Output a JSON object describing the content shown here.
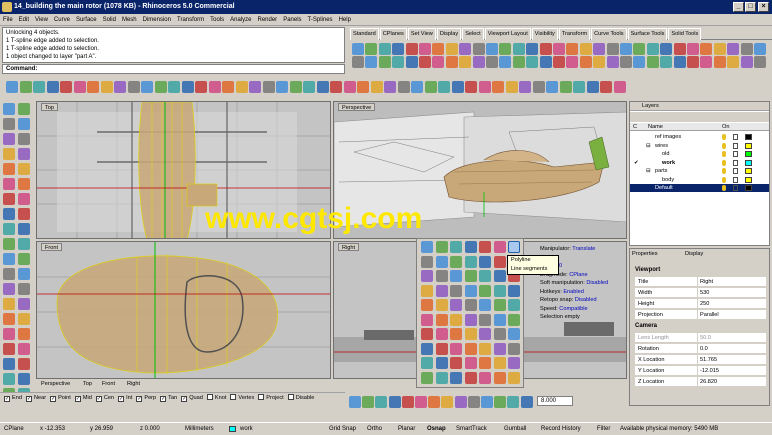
{
  "window": {
    "title": "14_building the main rotor (1078 KB) - Rhinoceros 5.0 Commercial",
    "controls": [
      "_",
      "□",
      "×"
    ]
  },
  "menu": [
    "File",
    "Edit",
    "View",
    "Curve",
    "Surface",
    "Solid",
    "Mesh",
    "Dimension",
    "Transform",
    "Tools",
    "Analyze",
    "Render",
    "Panels",
    "T-Splines",
    "Help"
  ],
  "command_history": [
    "Unlocking 4 objects.",
    "1 T-spline edge added to selection.",
    "1 T-spline edge added to selection.",
    "1 object changed to layer \"part A\"."
  ],
  "command_prompt": "Command:",
  "toolbar_tabs": [
    "Standard",
    "CPlanes",
    "Set View",
    "Display",
    "Select",
    "Viewport Layout",
    "Visibility",
    "Transform",
    "Curve Tools",
    "Surface Tools",
    "Solid Tools"
  ],
  "viewports": {
    "top": "Top",
    "perspective": "Perspective",
    "front": "Front",
    "right": "Right"
  },
  "viewport_tabs": [
    "Perspective",
    "Top",
    "Front",
    "Right"
  ],
  "layers": {
    "title": "Layers",
    "col_name": "Name",
    "col_on": "On",
    "rows": [
      {
        "name": "ref images",
        "indent": 1,
        "color": "#000000"
      },
      {
        "name": "wires",
        "indent": 1,
        "color": "#ffff00",
        "expand": "⊟"
      },
      {
        "name": "old",
        "indent": 2,
        "color": "#00ff00"
      },
      {
        "name": "work",
        "indent": 2,
        "color": "#00ffff",
        "bold": true,
        "check": "✔"
      },
      {
        "name": "parts",
        "indent": 1,
        "color": "#ffff00",
        "expand": "⊟"
      },
      {
        "name": "body",
        "indent": 2,
        "color": "#ffff00"
      },
      {
        "name": "Default",
        "indent": 1,
        "color": "#000000",
        "selected": true
      }
    ]
  },
  "properties": {
    "tab_properties": "Properties",
    "tab_display": "Display",
    "section_viewport": "Viewport",
    "section_camera": "Camera",
    "viewport_rows": [
      {
        "k": "Title",
        "v": "Right"
      },
      {
        "k": "Width",
        "v": "530"
      },
      {
        "k": "Height",
        "v": "250"
      },
      {
        "k": "Projection",
        "v": "Parallel"
      }
    ],
    "camera_rows": [
      {
        "k": "Lens Length",
        "v": "50.0"
      },
      {
        "k": "Rotation",
        "v": "0.0"
      },
      {
        "k": "X Location",
        "v": "51.765"
      },
      {
        "k": "Y Location",
        "v": "-12.015"
      },
      {
        "k": "Z Location",
        "v": "26.820"
      }
    ]
  },
  "tspline_info": [
    {
      "k": "Manipulator:",
      "v": "Translate"
    },
    {
      "k": "",
      "v": "Objects"
    },
    {
      "k": "er:",
      "v": "1.000"
    },
    {
      "k": "Dragmode:",
      "v": "CPlane"
    },
    {
      "k": "Soft manipulation:",
      "v": "Disabled"
    },
    {
      "k": "Hotkeys:",
      "v": "Enabled"
    },
    {
      "k": "Retopo snap:",
      "v": "Disabled"
    },
    {
      "k": "Speed:",
      "v": "Compatible"
    },
    {
      "k": "Selection empty",
      "v": ""
    }
  ],
  "tooltip": [
    "Polyline",
    "Line segments"
  ],
  "osnap": [
    {
      "label": "End",
      "checked": true
    },
    {
      "label": "Near",
      "checked": true
    },
    {
      "label": "Point",
      "checked": true
    },
    {
      "label": "Mid",
      "checked": true
    },
    {
      "label": "Cen",
      "checked": true
    },
    {
      "label": "Int",
      "checked": true
    },
    {
      "label": "Perp",
      "checked": true
    },
    {
      "label": "Tan",
      "checked": true
    },
    {
      "label": "Quad",
      "checked": true
    },
    {
      "label": "Knot",
      "checked": false
    },
    {
      "label": "Vertex",
      "checked": false
    },
    {
      "label": "Project",
      "checked": false
    },
    {
      "label": "Disable",
      "checked": false
    }
  ],
  "bottom_value": "8.000",
  "status": {
    "cplane": "CPlane",
    "x": "x -12.353",
    "y": "y 26.959",
    "z": "z 0.000",
    "units": "Millimeters",
    "layer": "work",
    "grid_snap": "Grid Snap",
    "ortho": "Ortho",
    "planar": "Planar",
    "osnap": "Osnap",
    "smarttrack": "SmartTrack",
    "gumball": "Gumball",
    "record_history": "Record History",
    "filter": "Filter",
    "memory": "Available physical memory: 5490 MB"
  },
  "watermark": "www.cgtsj.com",
  "colors": {
    "titlebar": "#0a246a",
    "model": "#c8a878",
    "watermark": "#ffe800",
    "viewport_bg": "#bdbdbd"
  }
}
